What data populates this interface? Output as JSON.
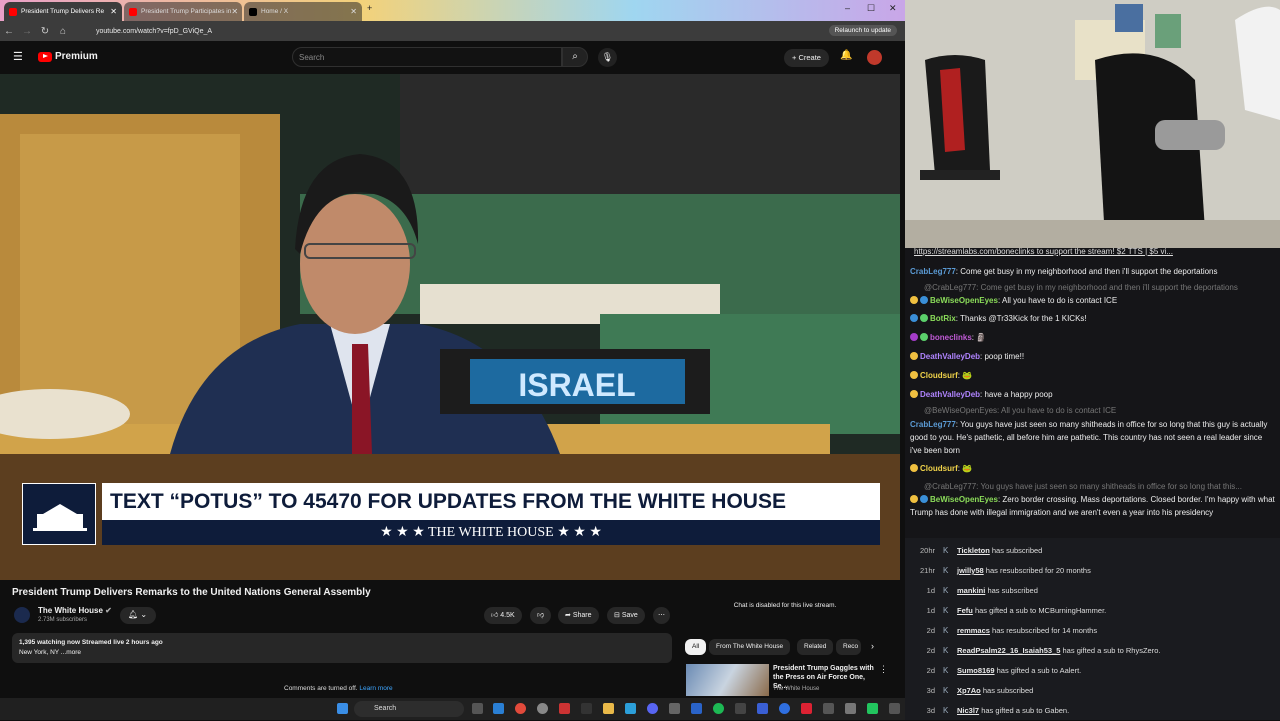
{
  "browser": {
    "tabs": [
      {
        "label": "President Trump Delivers Re",
        "active": true
      },
      {
        "label": "President Trump Participates in",
        "active": false
      },
      {
        "label": "Home / X",
        "active": false
      }
    ],
    "url": "youtube.com/watch?v=fpD_GViQe_A",
    "relaunch_label": "Relaunch to update"
  },
  "youtube": {
    "logo_text": "Premium",
    "search_placeholder": "Search",
    "create_label": "Create",
    "video": {
      "nameplate": "ISRAEL",
      "lower_third_main": "TEXT “POTUS” TO 45470 FOR UPDATES FROM THE WHITE HOUSE",
      "lower_third_sub": "★ ★ ★  THE WHITE HOUSE  ★ ★ ★"
    },
    "title": "President Trump Delivers Remarks to the United Nations General Assembly",
    "channel": {
      "name": "The White House",
      "subscribers": "2.73M subscribers"
    },
    "actions": {
      "likes": "4.5K",
      "share": "Share",
      "save": "Save"
    },
    "description": {
      "views": "1,395 watching now  Streamed live 2 hours ago",
      "location": "New York, NY ...more"
    },
    "comments_text": "Comments are turned off.",
    "comments_link": "Learn more",
    "chat_disabled": "Chat is disabled for this live stream.",
    "chips": [
      "All",
      "From The White House",
      "Related",
      "Reco"
    ],
    "recommended": {
      "title": "President Trump Gaggles with the Press on Air Force One, Se...",
      "channel": "The White House"
    }
  },
  "chat": {
    "banner": "https://streamlabs.com/boneclinks to support the stream! $2 TTS | $5 vi...",
    "messages": [
      {
        "user": "CrabLeg777",
        "text": "Come get busy in my neighborhood and then i'll support the deportations",
        "color": "#5b9bd5"
      },
      {
        "user": "",
        "text": "@CrabLeg777: Come get busy in my neighborhood and then i'll support the deportations",
        "color": "#777777"
      },
      {
        "user": "BeWiseOpenEyes",
        "text": "All you have to do is contact ICE",
        "color": "#8bdc5a"
      },
      {
        "user": "BotRix",
        "text": "Thanks @Tr33Kick for the 1 KICKs!",
        "color": "#8bdc5a"
      },
      {
        "user": "boneclinks",
        "text": "",
        "color": "#c05ad6"
      },
      {
        "user": "DeathValleyDeb",
        "text": "poop time!!",
        "color": "#b084ff"
      },
      {
        "user": "Cloudsurf",
        "text": "",
        "color": "#f0d34a"
      },
      {
        "user": "DeathValleyDeb",
        "text": "have a happy poop",
        "color": "#b084ff"
      },
      {
        "user": "",
        "text": "@BeWiseOpenEyes: All you have to do is contact ICE",
        "color": "#777777"
      },
      {
        "user": "CrabLeg777",
        "text": "You guys have just seen so many shitheads in office for so long that this guy is actually good to you. He's pathetic, all before him are pathetic. This country has not seen a real leader since i've been born",
        "color": "#5b9bd5"
      },
      {
        "user": "Cloudsurf",
        "text": "",
        "color": "#f0d34a"
      },
      {
        "user": "",
        "text": "@CrabLeg777: You guys have just seen so many shitheads in office for so long that this...",
        "color": "#777777"
      },
      {
        "user": "BeWiseOpenEyes",
        "text": "Zero border crossing. Mass deportations. Closed border. I'm happy with what Trump has done with illegal immigration and we aren't even a year into his presidency",
        "color": "#8bdc5a"
      }
    ]
  },
  "events": [
    {
      "time": "20hr",
      "name": "Tickleton",
      "action": "has subscribed"
    },
    {
      "time": "21hr",
      "name": "jwilly58",
      "action": "has resubscribed for 20 months"
    },
    {
      "time": "1d",
      "name": "mankini",
      "action": "has subscribed"
    },
    {
      "time": "1d",
      "name": "Fefu",
      "action": "has gifted a sub to MCBurningHammer."
    },
    {
      "time": "2d",
      "name": "remmacs",
      "action": "has resubscribed for 14 months"
    },
    {
      "time": "2d",
      "name": "ReadPsalm22_16_Isaiah53_5",
      "action": "has gifted a sub to RhysZero."
    },
    {
      "time": "2d",
      "name": "Sumo8169",
      "action": "has gifted a sub to Aalert."
    },
    {
      "time": "3d",
      "name": "Xp7Ao",
      "action": "has subscribed"
    },
    {
      "time": "3d",
      "name": "Nic3l7",
      "action": "has gifted a sub to Gaben."
    }
  ],
  "taskbar": {
    "search_label": "Search"
  }
}
